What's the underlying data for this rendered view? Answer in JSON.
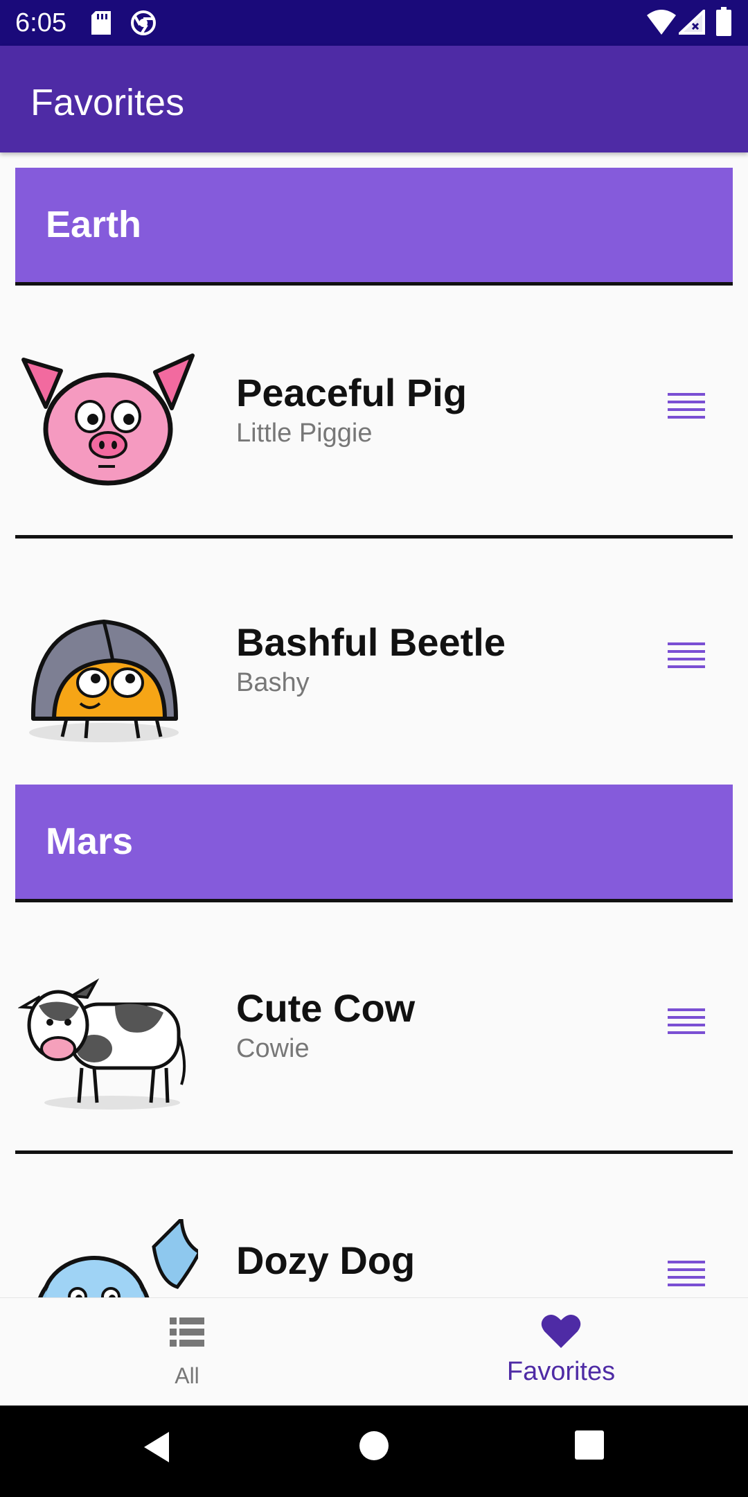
{
  "status_bar": {
    "time": "6:05",
    "left_icons": [
      "sd-card-icon",
      "chrome-icon"
    ],
    "right_icons": [
      "wifi-icon",
      "signal-icon",
      "battery-icon"
    ]
  },
  "app_bar": {
    "title": "Favorites"
  },
  "colors": {
    "status_bar": "#1a0a7a",
    "app_bar": "#4e2ba5",
    "section_header": "#855bdb",
    "accent": "#4e2ba5",
    "drag_handle": "#7a4fd3"
  },
  "sections": [
    {
      "title": "Earth",
      "items": [
        {
          "name": "Peaceful Pig",
          "nickname": "Little Piggie",
          "icon": "pig-illustration"
        },
        {
          "name": "Bashful Beetle",
          "nickname": "Bashy",
          "icon": "beetle-illustration"
        }
      ]
    },
    {
      "title": "Mars",
      "items": [
        {
          "name": "Cute Cow",
          "nickname": "Cowie",
          "icon": "cow-illustration"
        },
        {
          "name": "Dozy Dog",
          "nickname": "",
          "icon": "dog-illustration"
        }
      ]
    }
  ],
  "bottom_nav": {
    "items": [
      {
        "label": "All",
        "icon": "list-icon",
        "selected": false
      },
      {
        "label": "Favorites",
        "icon": "heart-icon",
        "selected": true
      }
    ]
  },
  "system_nav": {
    "buttons": [
      "back-icon",
      "home-icon",
      "recents-icon"
    ]
  }
}
